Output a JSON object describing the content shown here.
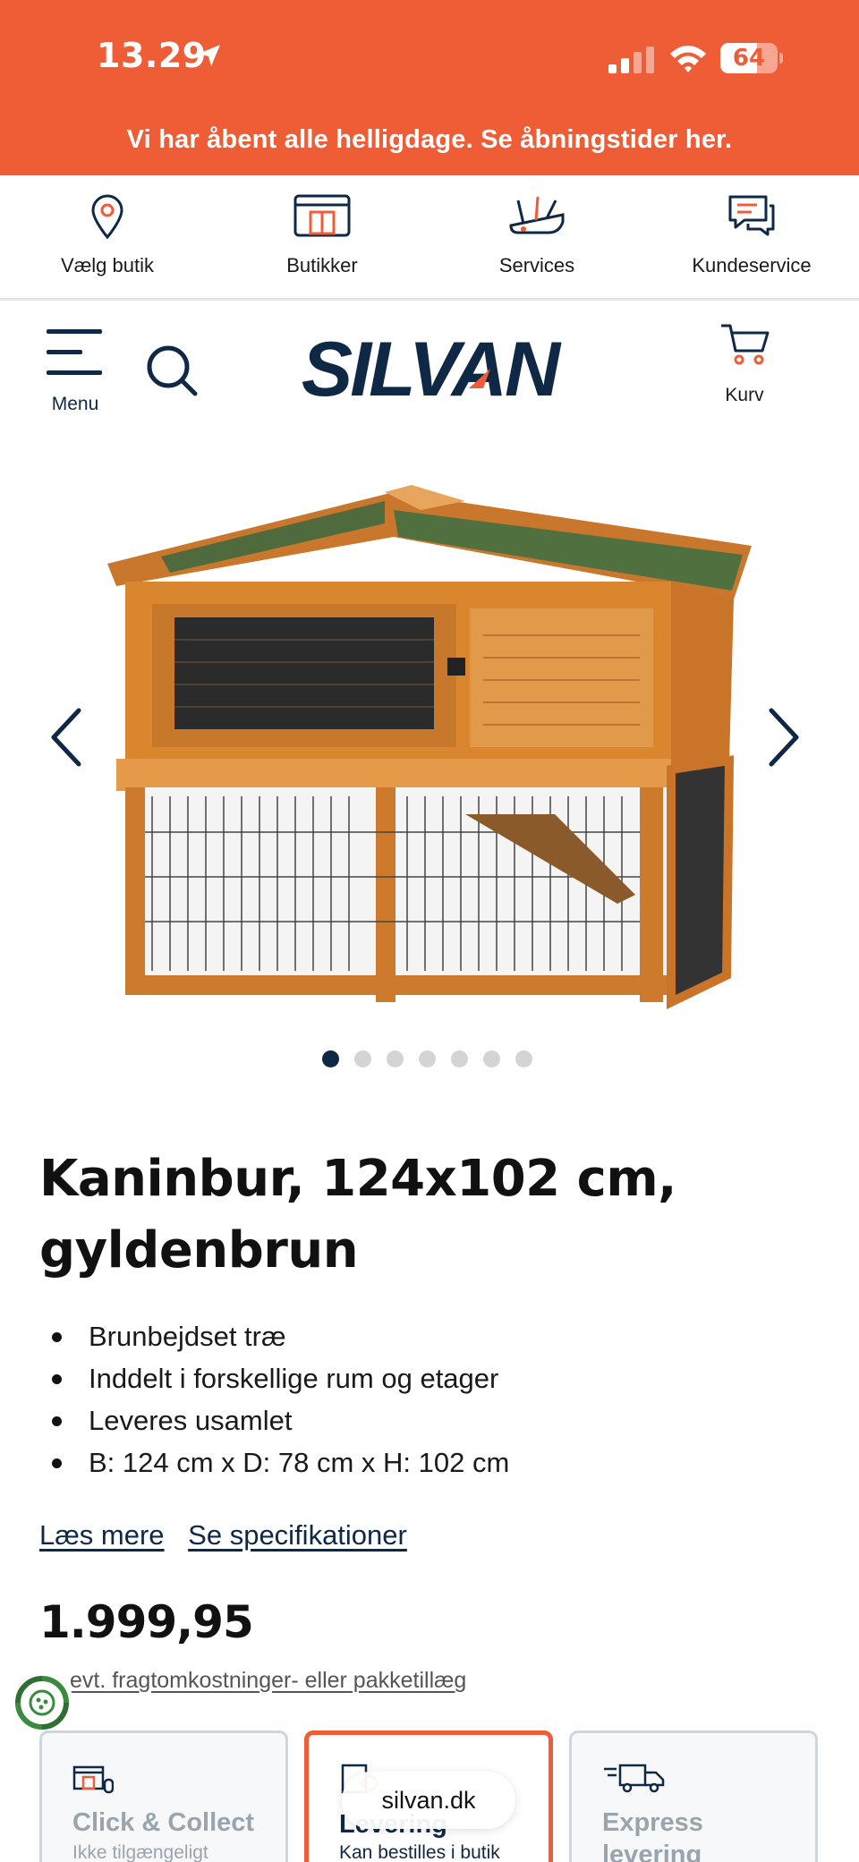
{
  "status_bar": {
    "time": "13.29",
    "battery": "64",
    "battery_level": 0.64
  },
  "banner": {
    "text": "Vi har åbent alle helligdage. Se åbningstider her."
  },
  "utility_nav": [
    {
      "label": "Vælg butik",
      "icon": "location-pin-icon"
    },
    {
      "label": "Butikker",
      "icon": "storefront-icon"
    },
    {
      "label": "Services",
      "icon": "tools-icon"
    },
    {
      "label": "Kundeservice",
      "icon": "chat-bubbles-icon"
    }
  ],
  "header": {
    "menu_label": "Menu",
    "logo_text": "SILVAN",
    "cart_label": "Kurv"
  },
  "gallery": {
    "dot_count": 7,
    "active_index": 0
  },
  "product": {
    "title_line1": "Kaninbur, 124x102 cm,",
    "title_line2": "gyldenbrun",
    "bullets": [
      "Brunbejdset træ",
      "Inddelt i forskellige rum og etager",
      "Leveres usamlet",
      "B: 124 cm x D: 78 cm x H: 102 cm"
    ],
    "read_more": "Læs mere",
    "specs": "Se specifikationer",
    "price": "1.999,95",
    "freight_note": "evt. fragtomkostninger- eller pakketillæg"
  },
  "delivery_options": [
    {
      "title": "Click & Collect",
      "subtitle": "Ikke tilgængeligt",
      "icon": "click-collect-icon"
    },
    {
      "title": "Levering",
      "subtitle": "Kan bestilles i butik",
      "icon": "delivery-box-icon"
    },
    {
      "title": "Express levering",
      "subtitle": "",
      "icon": "express-truck-icon"
    }
  ],
  "browser": {
    "url": "silvan.dk"
  },
  "colors": {
    "brand_orange": "#ef5d37",
    "navy": "#0f2846"
  }
}
